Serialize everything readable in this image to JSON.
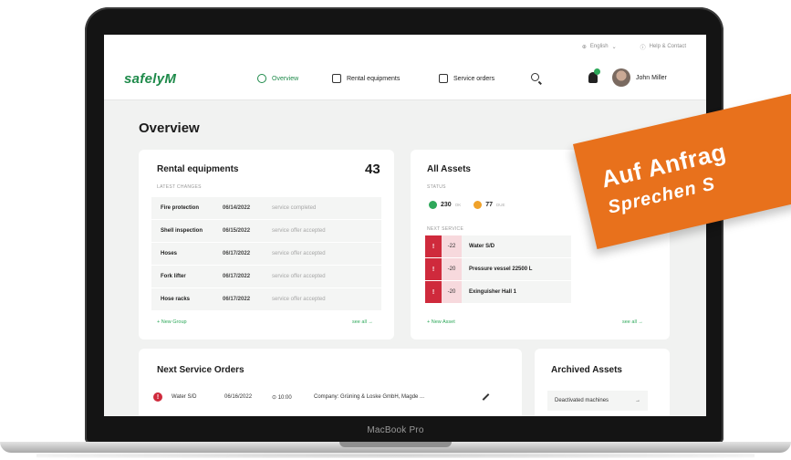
{
  "device": {
    "bezel_label": "MacBook Pro"
  },
  "topbar": {
    "language": "English",
    "help": "Help & Contact"
  },
  "nav": {
    "logo": "safelyM",
    "items": [
      {
        "label": "Overview",
        "active": true
      },
      {
        "label": "Rental equipments",
        "active": false
      },
      {
        "label": "Service orders",
        "active": false
      }
    ],
    "user_name": "John Miller"
  },
  "page": {
    "title": "Overview"
  },
  "rental": {
    "title": "Rental equipments",
    "count": "43",
    "section_label": "LATEST CHANGES",
    "rows": [
      {
        "name": "Fire protection",
        "date": "06/14/2022",
        "status": "service completed"
      },
      {
        "name": "Shell inspection",
        "date": "06/15/2022",
        "status": "service offer accepted"
      },
      {
        "name": "Hoses",
        "date": "06/17/2022",
        "status": "service offer accepted"
      },
      {
        "name": "Fork lifter",
        "date": "06/17/2022",
        "status": "service offer accepted"
      },
      {
        "name": "Hose racks",
        "date": "06/17/2022",
        "status": "service offer accepted"
      }
    ],
    "new_group": "+ New Group",
    "see_all": "see all →"
  },
  "assets": {
    "title": "All Assets",
    "status_label": "STATUS",
    "statuses": [
      {
        "count": "230",
        "label": "OK",
        "color": "#2ea85a"
      },
      {
        "count": "77",
        "label": "DUE",
        "color": "#f0a22a"
      }
    ],
    "next_service_label": "NEXT SERVICE",
    "next_service": [
      {
        "days": "-22",
        "name": "Water S/D"
      },
      {
        "days": "-20",
        "name": "Pressure vessel 22500 L"
      },
      {
        "days": "-20",
        "name": "Exinguisher Hall 1"
      }
    ],
    "new_asset": "+ New Asset",
    "see_all": "see all →"
  },
  "orders": {
    "title": "Next Service Orders",
    "rows": [
      {
        "name": "Water S/D",
        "date": "06/16/2022",
        "time": "⊙ 10:00",
        "company": "Company: Grüning & Loske GmbH, Magde ..."
      }
    ]
  },
  "archived": {
    "title": "Archived Assets",
    "row": "Deactivated machines",
    "arrow": "→"
  },
  "promo": {
    "line1": "Auf Anfrag",
    "line2": "Sprechen S"
  },
  "colors": {
    "brand_green": "#1e8a4a",
    "alert_red": "#cf2a3c",
    "promo_orange": "#e8711c"
  }
}
